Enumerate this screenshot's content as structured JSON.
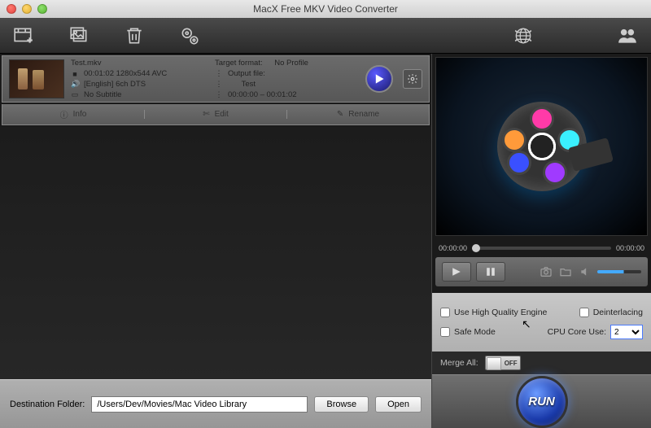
{
  "window": {
    "title": "MacX Free MKV Video Converter"
  },
  "file": {
    "name": "Test.mkv",
    "duration_res": "00:01:02 1280x544 AVC",
    "audio": "[English] 6ch DTS",
    "subtitle": "No Subtitle",
    "target_label": "Target format:",
    "target_value": "No Profile",
    "output_label": "Output file:",
    "output_value": "Test",
    "range": "00:00:00 – 00:01:02"
  },
  "actions": {
    "info": "Info",
    "edit": "Edit",
    "rename": "Rename"
  },
  "timeline": {
    "start": "00:00:00",
    "end": "00:00:00"
  },
  "options": {
    "hq": "Use High Quality Engine",
    "deint": "Deinterlacing",
    "safe": "Safe Mode",
    "cpu_label": "CPU Core Use:",
    "cpu_value": "2"
  },
  "merge": {
    "label": "Merge All:",
    "state": "OFF"
  },
  "dest": {
    "label": "Destination Folder:",
    "path": "/Users/Dev/Movies/Mac Video Library",
    "browse": "Browse",
    "open": "Open"
  },
  "run": "RUN"
}
